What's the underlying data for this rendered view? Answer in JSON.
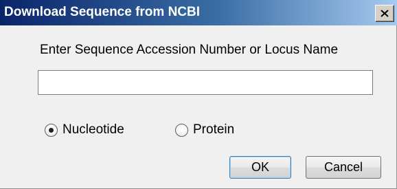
{
  "window": {
    "title": "Download Sequence from NCBI",
    "close_icon": "close-icon"
  },
  "form": {
    "prompt": "Enter Sequence Accession Number or Locus Name",
    "input_value": "",
    "input_placeholder": ""
  },
  "radios": {
    "nucleotide": {
      "label": "Nucleotide",
      "checked": true
    },
    "protein": {
      "label": "Protein",
      "checked": false
    }
  },
  "buttons": {
    "ok_label": "OK",
    "cancel_label": "Cancel"
  },
  "colors": {
    "titlebar_start": "#0a246a",
    "titlebar_end": "#a6caf0",
    "dialog_bg": "#f0f0f0",
    "default_button_border": "#3c7fb1"
  }
}
